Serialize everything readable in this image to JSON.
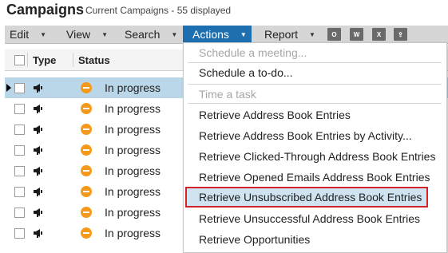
{
  "header": {
    "title": "Campaigns",
    "subtitle": "Current Campaigns - 55 displayed"
  },
  "menubar": {
    "edit": "Edit",
    "view": "View",
    "search": "Search",
    "actions": "Actions",
    "report": "Report",
    "icons": [
      "outlook-icon",
      "word-icon",
      "excel-icon",
      "export-icon"
    ]
  },
  "grid": {
    "columns": [
      "Type",
      "Status"
    ],
    "rows": [
      {
        "status": "In progress",
        "selected": true
      },
      {
        "status": "In progress",
        "selected": false
      },
      {
        "status": "In progress",
        "selected": false
      },
      {
        "status": "In progress",
        "selected": false
      },
      {
        "status": "In progress",
        "selected": false
      },
      {
        "status": "In progress",
        "selected": false
      },
      {
        "status": "In progress",
        "selected": false
      },
      {
        "status": "In progress",
        "selected": false
      }
    ]
  },
  "actions_menu": {
    "items": [
      {
        "label": "Schedule a meeting...",
        "disabled": true
      },
      {
        "label": "Schedule a to-do...",
        "disabled": false
      },
      {
        "label": "Time a task",
        "disabled": true
      },
      {
        "label": "Retrieve Address Book Entries",
        "disabled": false
      },
      {
        "label": "Retrieve Address Book Entries by Activity...",
        "disabled": false
      },
      {
        "label": "Retrieve Clicked-Through Address Book Entries",
        "disabled": false
      },
      {
        "label": "Retrieve Opened Emails Address Book Entries",
        "disabled": false
      },
      {
        "label": "Retrieve Unsubscribed Address Book Entries",
        "disabled": false,
        "highlighted": true
      },
      {
        "label": "Retrieve Unsuccessful Address Book Entries",
        "disabled": false
      },
      {
        "label": "Retrieve Opportunities",
        "disabled": false
      }
    ]
  },
  "colors": {
    "active_menu": "#1e6fb0",
    "selected_row": "#b9d7e8",
    "status_in_progress": "#f59a1b",
    "highlight_border": "#d4222a"
  }
}
